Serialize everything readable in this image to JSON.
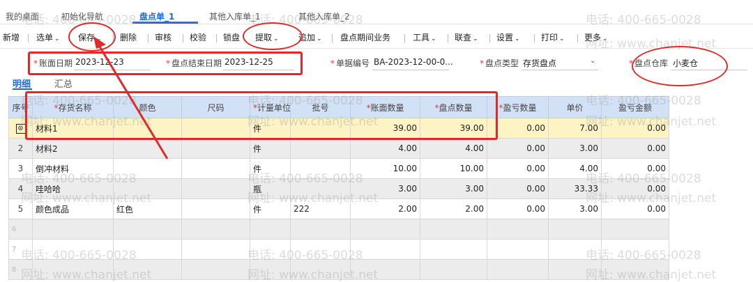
{
  "tabs": [
    {
      "label": "我的桌面"
    },
    {
      "label": "初始化导航"
    },
    {
      "label": "盘点单_1"
    },
    {
      "label": "其他入库单_1"
    },
    {
      "label": "其他入库单_2"
    }
  ],
  "toolbar": {
    "new": "新增",
    "select": "选单",
    "save": "保存",
    "delete": "删除",
    "audit": "审核",
    "verify": "校验",
    "lock": "锁盘",
    "extract": "提取",
    "append": "追加",
    "period_business": "盘点期间业务",
    "tools": "工具",
    "linked_query": "联查",
    "settings": "设置",
    "print": "打印",
    "more": "更多"
  },
  "form": {
    "book_date_label": "账面日期",
    "book_date_value": "2023-12-23",
    "end_date_label": "盘点结束日期",
    "end_date_value": "2023-12-25",
    "doc_no_label": "单据编号",
    "doc_no_value": "BA-2023-12-00-0...",
    "type_label": "盘点类型",
    "type_value": "存货盘点",
    "warehouse_label": "盘点仓库",
    "warehouse_value": "小麦仓"
  },
  "subtabs": {
    "detail": "明细",
    "summary": "汇总"
  },
  "table": {
    "headers": {
      "seq": "序号",
      "name": "存货名称",
      "color": "颜色",
      "size": "尺码",
      "unit": "计量单位",
      "batch": "批号",
      "book_qty": "账面数量",
      "count_qty": "盘点数量",
      "diff_qty": "盈亏数量",
      "price": "单价",
      "diff_amt": "盈亏金额"
    },
    "rows": [
      {
        "seq": "",
        "name": "材料1",
        "color": "",
        "size": "",
        "unit": "件",
        "batch": "",
        "book_qty": "39.00",
        "count_qty": "39.00",
        "diff_qty": "0.00",
        "price": "7.00",
        "diff_amt": "0.00"
      },
      {
        "seq": "2",
        "name": "材料2",
        "color": "",
        "size": "",
        "unit": "件",
        "batch": "",
        "book_qty": "4.00",
        "count_qty": "4.00",
        "diff_qty": "0.00",
        "price": "3.00",
        "diff_amt": "0.00"
      },
      {
        "seq": "3",
        "name": "倒冲材料",
        "color": "",
        "size": "",
        "unit": "件",
        "batch": "",
        "book_qty": "10.00",
        "count_qty": "10.00",
        "diff_qty": "0.00",
        "price": "4.00",
        "diff_amt": "0.00"
      },
      {
        "seq": "4",
        "name": "哇哈哈",
        "color": "",
        "size": "",
        "unit": "瓶",
        "batch": "",
        "book_qty": "3.00",
        "count_qty": "3.00",
        "diff_qty": "0.00",
        "price": "33.33",
        "diff_amt": "0.00"
      },
      {
        "seq": "5",
        "name": "颜色成品",
        "color": "红色",
        "size": "",
        "unit": "件",
        "batch": "222",
        "book_qty": "2.00",
        "count_qty": "2.00",
        "diff_qty": "0.00",
        "price": "3.00",
        "diff_amt": "0.00"
      }
    ],
    "row1_marker": "⊙",
    "empty_rows": [
      "6",
      "7",
      "8"
    ]
  },
  "watermark": {
    "phone": "电话: 400-665-0028",
    "site": "网址: www.chanjet.net"
  },
  "annotation_color": "#e02a2a"
}
